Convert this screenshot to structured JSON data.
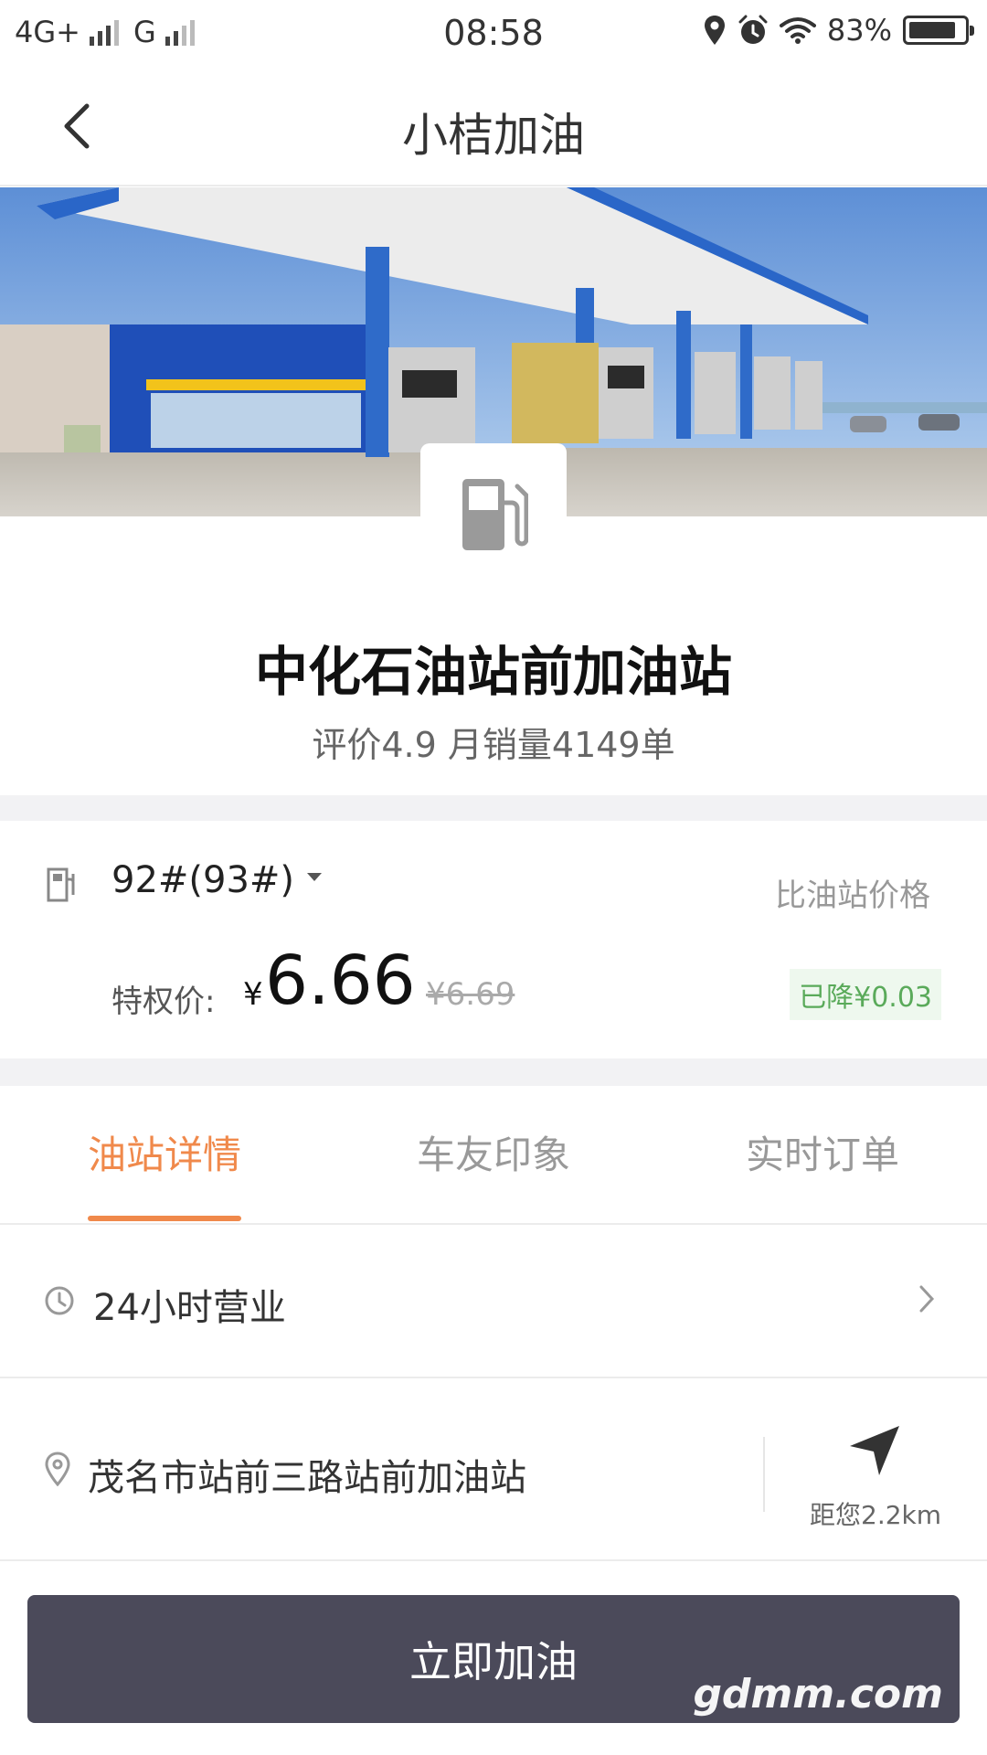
{
  "status_bar": {
    "network1": "4G+",
    "network2": "G",
    "time": "08:58",
    "battery_percent": "83%",
    "battery_level": 0.83,
    "icons": [
      "location-icon",
      "alarm-icon",
      "wifi-icon",
      "battery-icon"
    ]
  },
  "nav": {
    "title": "小桔加油",
    "back_icon": "chevron-left-icon"
  },
  "station": {
    "name": "中化石油站前加油站",
    "meta": "评价4.9  月销量4149单"
  },
  "price": {
    "fuel_grade": "92#(93#)",
    "compare_link": "比油站价格",
    "label": "特权价:",
    "currency": "¥",
    "value": "6.66",
    "old_price": "¥6.69",
    "discount": "已降¥0.03"
  },
  "tabs": [
    {
      "label": "油站详情",
      "active": true
    },
    {
      "label": "车友印象",
      "active": false
    },
    {
      "label": "实时订单",
      "active": false
    }
  ],
  "details": {
    "hours": "24小时营业",
    "address": "茂名市站前三路站前加油站",
    "distance": "距您2.2km"
  },
  "cta": {
    "label": "立即加油"
  },
  "watermark": "gdmm.com",
  "colors": {
    "accent": "#f0894b",
    "cta_bg": "#4b4a5a",
    "discount_text": "#5aaa5a",
    "discount_bg": "#eef8ee"
  }
}
